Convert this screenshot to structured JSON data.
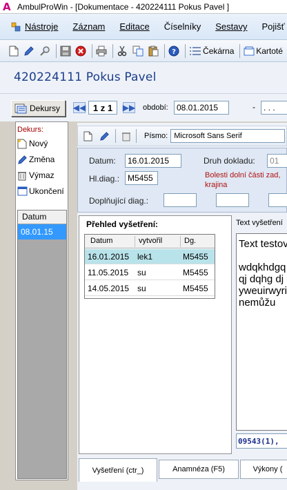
{
  "window": {
    "title": "AmbulProWin  - [Dokumentace - 420224111 Pokus Pavel ]"
  },
  "menu": {
    "items": [
      {
        "label": "Nástroje"
      },
      {
        "label": "Záznam"
      },
      {
        "label": "Editace"
      },
      {
        "label": "Číselníky"
      },
      {
        "label": "Sestavy"
      },
      {
        "label": "Pojišť"
      }
    ]
  },
  "toolbar": {
    "cekarna": "Čekárna",
    "kartoteka": "Kartoté"
  },
  "patient": {
    "name": "420224111 Pokus Pavel"
  },
  "nav": {
    "dekurs_button": "Dekursy",
    "pager": "1 z 1",
    "obdobi_label": "období:",
    "obdobi_value": "08.01.2015",
    "obdobi_sep": "-",
    "obdobi_value2": ". . ."
  },
  "dekurs_panel": {
    "title": "Dekurs:",
    "actions": [
      {
        "label": "Nový",
        "icon": "new-document-icon"
      },
      {
        "label": "Změna",
        "icon": "pencil-icon"
      },
      {
        "label": "Výmaz",
        "icon": "trash-icon"
      },
      {
        "label": "Ukončení",
        "icon": "close-window-icon"
      }
    ],
    "list_header": "Datum",
    "list_rows": [
      "08.01.15"
    ]
  },
  "subtoolbar": {
    "pismo_label": "Písmo:",
    "font_value": "Microsoft Sans Serif"
  },
  "form": {
    "datum_label": "Datum:",
    "datum_value": "16.01.2015",
    "hldiag_label": "Hl.diag.:",
    "hldiag_value": "M5455",
    "druh_label": "Druh dokladu:",
    "druh_value": "01",
    "druh_desc_line1": "Bolesti dolní části zad,",
    "druh_desc_line2": "krajina",
    "doplnujici_label": "Doplňující diag.:"
  },
  "exams": {
    "title": "Přehled vyšetření:",
    "columns": [
      "Datum",
      "vytvořil",
      "Dg."
    ],
    "rows": [
      {
        "datum": "16.01.2015",
        "vytvoril": "lek1",
        "dg": "M5455",
        "selected": true
      },
      {
        "datum": "11.05.2015",
        "vytvoril": "su",
        "dg": "M5455",
        "selected": false
      },
      {
        "datum": "14.05.2015",
        "vytvoril": "su",
        "dg": "M5455",
        "selected": false
      }
    ]
  },
  "text_pane": {
    "title": "Text vyšetření",
    "first_line": "Text testov",
    "lines": [
      "wdqkhdgq",
      "qj dqhg dj",
      "yweuirwyri",
      "nemůžu"
    ],
    "code": "09543(1),"
  },
  "tabs": [
    {
      "label": "Vyšetření (ctr_)",
      "active": true
    },
    {
      "label": "Anamnéza (F5)",
      "active": false
    },
    {
      "label": "Výkony (",
      "active": false
    }
  ]
}
